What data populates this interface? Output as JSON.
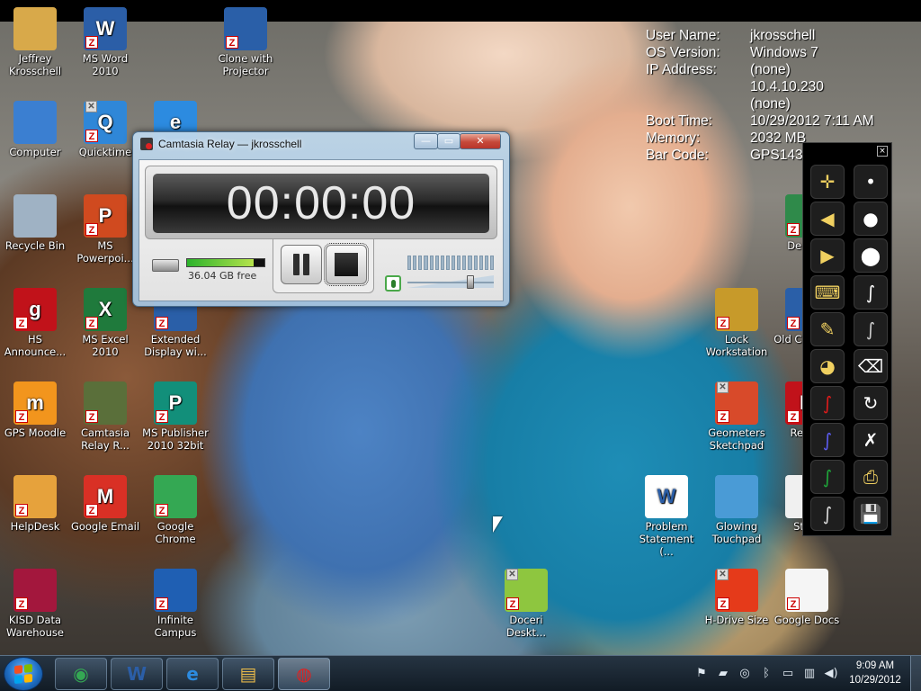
{
  "desktop": {
    "icons": [
      {
        "label": "Jeffrey Krosschell",
        "icon": "user-folder-icon",
        "color": "#d8a94a",
        "glyph": "",
        "z": false,
        "x": false
      },
      {
        "label": "MS Word 2010",
        "icon": "word-icon",
        "color": "#2b5ea7",
        "glyph": "W",
        "z": true,
        "x": false
      },
      {
        "label": "Clone with Projector",
        "icon": "display-clone-icon",
        "color": "#2a5fa8",
        "glyph": "",
        "z": true,
        "x": false
      },
      {
        "label": "Computer",
        "icon": "computer-icon",
        "color": "#3b7fd1",
        "glyph": "",
        "z": false,
        "x": false
      },
      {
        "label": "Quicktime",
        "icon": "quicktime-icon",
        "color": "#2f87d8",
        "glyph": "Q",
        "z": true,
        "x": true
      },
      {
        "label": "",
        "icon": "internet-explorer-icon",
        "color": "#2c8be0",
        "glyph": "e",
        "z": false,
        "x": false
      },
      {
        "label": "Recycle Bin",
        "icon": "recycle-bin-icon",
        "color": "#9fb2c4",
        "glyph": "",
        "z": false,
        "x": false
      },
      {
        "label": "MS Powerpoi...",
        "icon": "powerpoint-icon",
        "color": "#d04a1f",
        "glyph": "P",
        "z": true,
        "x": false
      },
      {
        "label": "HS Announce...",
        "icon": "announcement-icon",
        "color": "#c1121a",
        "glyph": "g",
        "z": true,
        "x": false
      },
      {
        "label": "MS Excel 2010",
        "icon": "excel-icon",
        "color": "#1f7a3c",
        "glyph": "X",
        "z": true,
        "x": false
      },
      {
        "label": "Extended Display wi...",
        "icon": "display-extend-icon",
        "color": "#2a5fa8",
        "glyph": "",
        "z": true,
        "x": false
      },
      {
        "label": "GPS Moodle",
        "icon": "moodle-icon",
        "color": "#f2951d",
        "glyph": "m",
        "z": true,
        "x": false
      },
      {
        "label": "Camtasia Relay R...",
        "icon": "camtasia-relay-icon",
        "color": "#5a6f3a",
        "glyph": "",
        "z": true,
        "x": false
      },
      {
        "label": "MS Publisher 2010 32bit",
        "icon": "publisher-icon",
        "color": "#128f7a",
        "glyph": "P",
        "z": true,
        "x": false
      },
      {
        "label": "HelpDesk",
        "icon": "helpdesk-icon",
        "color": "#e6a23c",
        "glyph": "",
        "z": true,
        "x": false
      },
      {
        "label": "Google Email",
        "icon": "gmail-icon",
        "color": "#d93025",
        "glyph": "M",
        "z": true,
        "x": false
      },
      {
        "label": "Google Chrome",
        "icon": "chrome-icon",
        "color": "#34a853",
        "glyph": "",
        "z": true,
        "x": false
      },
      {
        "label": "KISD Data Warehouse",
        "icon": "data-warehouse-icon",
        "color": "#a3173d",
        "glyph": "",
        "z": true,
        "x": false
      },
      {
        "label": "Infinite Campus",
        "icon": "infinite-campus-icon",
        "color": "#1f5fb3",
        "glyph": "",
        "z": true,
        "x": false
      },
      {
        "label": "Doceri Deskt...",
        "icon": "doceri-icon",
        "color": "#8ec63f",
        "glyph": "",
        "z": true,
        "x": true
      },
      {
        "label": "Lock Workstation",
        "icon": "padlock-icon",
        "color": "#c79a2a",
        "glyph": "",
        "z": true,
        "x": false
      },
      {
        "label": "Old C Reco...",
        "icon": "recovery-icon",
        "color": "#2a5fa8",
        "glyph": "",
        "z": true,
        "x": false
      },
      {
        "label": "Geometers Sketchpad",
        "icon": "sketchpad-icon",
        "color": "#d84a2a",
        "glyph": "",
        "z": true,
        "x": true
      },
      {
        "label": "RecP...",
        "icon": "recp-icon",
        "color": "#c1121a",
        "glyph": "R",
        "z": true,
        "x": false
      },
      {
        "label": "De Fo...",
        "icon": "deep-freeze-icon",
        "color": "#2f8a4a",
        "glyph": "",
        "z": true,
        "x": false
      },
      {
        "label": "Problem Statement (...",
        "icon": "word-document-icon",
        "color": "#ffffff",
        "glyph": "W",
        "z": false,
        "x": false
      },
      {
        "label": "Glowing Touchpad",
        "icon": "touchpad-icon",
        "color": "#4a9bd6",
        "glyph": "",
        "z": false,
        "x": false
      },
      {
        "label": "Sta...",
        "icon": "document-icon",
        "color": "#f0f0f0",
        "glyph": "",
        "z": false,
        "x": false
      },
      {
        "label": "H-Drive Size",
        "icon": "pie-chart-icon",
        "color": "#e53a1a",
        "glyph": "",
        "z": true,
        "x": true
      },
      {
        "label": "Google Docs",
        "icon": "google-docs-icon",
        "color": "#f5f5f5",
        "glyph": "",
        "z": true,
        "x": false
      }
    ]
  },
  "bginfo": {
    "rows": [
      {
        "key": "User Name:",
        "value": "jkrosschell"
      },
      {
        "key": "OS Version:",
        "value": "Windows 7"
      },
      {
        "key": "IP Address:",
        "value": "(none)"
      },
      {
        "key": "",
        "value": "10.4.10.230"
      },
      {
        "key": "",
        "value": "(none)"
      },
      {
        "key": "Boot Time:",
        "value": "10/29/2012 7:11 AM"
      },
      {
        "key": "Memory:",
        "value": "2032 MB"
      },
      {
        "key": "Bar Code:",
        "value": "GPS143"
      }
    ]
  },
  "relay": {
    "title": "Camtasia Relay — jkrosschell",
    "timer": "00:00:00",
    "disk_free": "36.04 GB free",
    "disk_used_fraction": 0.86,
    "volume_level": 0.75,
    "min_glyph": "—",
    "max_glyph": "▭",
    "close_glyph": "✕"
  },
  "pen_toolbar": {
    "close_glyph": "×",
    "tools": [
      {
        "name": "pointer-tool-icon",
        "glyph": "✛",
        "color": "#f0d060"
      },
      {
        "name": "dot-small-icon",
        "glyph": "•",
        "color": "#ffffff"
      },
      {
        "name": "arrow-left-icon",
        "glyph": "◀",
        "color": "#f0d060"
      },
      {
        "name": "dot-medium-icon",
        "glyph": "●",
        "color": "#ffffff"
      },
      {
        "name": "arrow-right-icon",
        "glyph": "▶",
        "color": "#f0d060"
      },
      {
        "name": "dot-large-icon",
        "glyph": "⬤",
        "color": "#ffffff"
      },
      {
        "name": "keyboard-icon",
        "glyph": "⌨",
        "color": "#f0d060"
      },
      {
        "name": "stroke-thin-icon",
        "glyph": "∫",
        "color": "#ffffff"
      },
      {
        "name": "pen-cursor-icon",
        "glyph": "✎",
        "color": "#f0d060"
      },
      {
        "name": "stroke-dashed-icon",
        "glyph": "∫",
        "color": "#cccccc"
      },
      {
        "name": "palette-icon",
        "glyph": "◕",
        "color": "#f0d060"
      },
      {
        "name": "eraser-icon",
        "glyph": "⌫",
        "color": "#ffffff"
      },
      {
        "name": "pen-red-icon",
        "glyph": "∫",
        "color": "#e01b1b"
      },
      {
        "name": "lasso-icon",
        "glyph": "↻",
        "color": "#ffffff"
      },
      {
        "name": "pen-blue-icon",
        "glyph": "∫",
        "color": "#5c5cf0"
      },
      {
        "name": "clear-ink-icon",
        "glyph": "✗",
        "color": "#ffffff"
      },
      {
        "name": "pen-green-icon",
        "glyph": "∫",
        "color": "#1fa83a"
      },
      {
        "name": "print-icon",
        "glyph": "⎙",
        "color": "#f0d060"
      },
      {
        "name": "pen-black-icon",
        "glyph": "∫",
        "color": "#dddddd"
      },
      {
        "name": "save-icon",
        "glyph": "💾",
        "color": "#f0d060"
      }
    ]
  },
  "taskbar": {
    "pinned": [
      {
        "name": "taskbar-chrome-button",
        "icon": "chrome-icon",
        "glyph": "◉",
        "color": "#34a853"
      },
      {
        "name": "taskbar-word-button",
        "icon": "word-icon",
        "glyph": "W",
        "color": "#2b5ea7"
      },
      {
        "name": "taskbar-ie-button",
        "icon": "internet-explorer-icon",
        "glyph": "e",
        "color": "#2c8be0"
      },
      {
        "name": "taskbar-explorer-button",
        "icon": "folder-icon",
        "glyph": "▤",
        "color": "#e6b84a"
      },
      {
        "name": "taskbar-relay-button",
        "icon": "camtasia-relay-icon",
        "glyph": "◍",
        "color": "#d22"
      }
    ],
    "tray": [
      {
        "name": "action-center-icon",
        "glyph": "⚑"
      },
      {
        "name": "network-flag-icon",
        "glyph": "▰"
      },
      {
        "name": "update-icon",
        "glyph": "◎"
      },
      {
        "name": "bluetooth-icon",
        "glyph": "ᛒ"
      },
      {
        "name": "display-icon",
        "glyph": "▭"
      },
      {
        "name": "network-icon",
        "glyph": "▥"
      },
      {
        "name": "volume-icon",
        "glyph": "◀)"
      }
    ],
    "clock_time": "9:09 AM",
    "clock_date": "10/29/2012"
  }
}
